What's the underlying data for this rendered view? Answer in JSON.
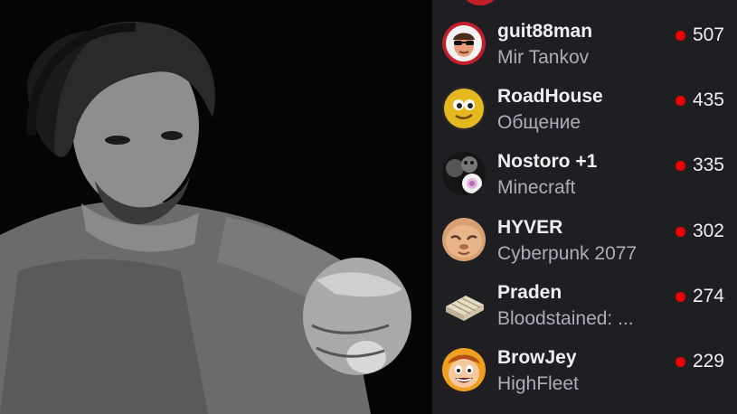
{
  "theme": {
    "accent": "#eb0400",
    "sidebar_bg": "#1f1f23",
    "name_color": "#efeff1",
    "game_color": "#adadb8"
  },
  "channels": [
    {
      "name": "guit88man",
      "game": "Mir Tankov",
      "viewers": "507",
      "avatar_icon": "red-sunglasses-avatar"
    },
    {
      "name": "RoadHouse",
      "game": "Общение",
      "viewers": "435",
      "avatar_icon": "yellow-smiley-avatar"
    },
    {
      "name": "Nostoro +1",
      "game": "Minecraft",
      "viewers": "335",
      "avatar_icon": "dark-group-avatar"
    },
    {
      "name": "HYVER",
      "game": "Cyberpunk 2077",
      "viewers": "302",
      "avatar_icon": "cat-face-avatar"
    },
    {
      "name": "Praden",
      "game": "Bloodstained: ...",
      "viewers": "274",
      "avatar_icon": "pallet-avatar"
    },
    {
      "name": "BrowJey",
      "game": "HighFleet",
      "viewers": "229",
      "avatar_icon": "cartoon-face-avatar"
    }
  ]
}
